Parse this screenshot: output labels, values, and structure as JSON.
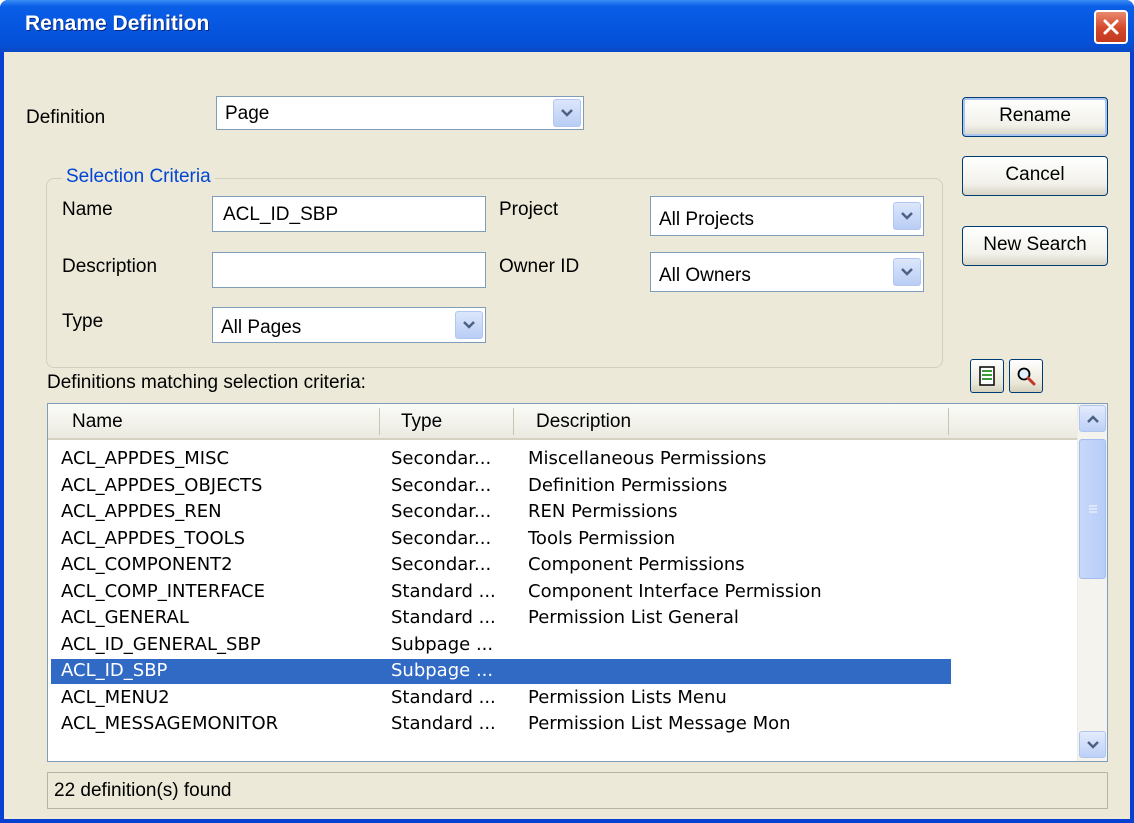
{
  "window": {
    "title": "Rename Definition"
  },
  "definition": {
    "label": "Definition",
    "value": "Page"
  },
  "buttons": {
    "rename": "Rename",
    "cancel": "Cancel",
    "new_search": "New Search"
  },
  "criteria": {
    "title": "Selection Criteria",
    "name_label": "Name",
    "name_value": "ACL_ID_SBP",
    "description_label": "Description",
    "description_value": "",
    "type_label": "Type",
    "type_value": "All Pages",
    "project_label": "Project",
    "project_value": "All Projects",
    "owner_label": "Owner ID",
    "owner_value": "All Owners"
  },
  "list": {
    "caption": "Definitions matching selection criteria:",
    "headers": [
      "Name",
      "Type",
      "Description"
    ],
    "rows": [
      {
        "name": "ACL_APPDES_MISC",
        "type": "Secondar...",
        "desc": "Miscellaneous Permissions"
      },
      {
        "name": "ACL_APPDES_OBJECTS",
        "type": "Secondar...",
        "desc": "Definition Permissions"
      },
      {
        "name": "ACL_APPDES_REN",
        "type": "Secondar...",
        "desc": "REN Permissions"
      },
      {
        "name": "ACL_APPDES_TOOLS",
        "type": "Secondar...",
        "desc": "Tools Permission"
      },
      {
        "name": "ACL_COMPONENT2",
        "type": "Secondar...",
        "desc": "Component Permissions"
      },
      {
        "name": "ACL_COMP_INTERFACE",
        "type": "Standard ...",
        "desc": "Component Interface Permission"
      },
      {
        "name": "ACL_GENERAL",
        "type": "Standard ...",
        "desc": "Permission List General"
      },
      {
        "name": "ACL_ID_GENERAL_SBP",
        "type": "Subpage ...",
        "desc": ""
      },
      {
        "name": "ACL_ID_SBP",
        "type": "Subpage ...",
        "desc": "",
        "selected": true
      },
      {
        "name": "ACL_MENU2",
        "type": "Standard ...",
        "desc": "Permission Lists Menu"
      },
      {
        "name": "ACL_MESSAGEMONITOR",
        "type": "Standard ...",
        "desc": "Permission List Message Mon"
      }
    ]
  },
  "status": {
    "text": "22 definition(s) found"
  },
  "icons": {
    "close": "close-icon",
    "dropdown": "chevron-down-icon",
    "properties": "properties-icon",
    "search": "magnifier-icon"
  },
  "colors": {
    "title_bar": "#0656e0",
    "selection": "#316ac5",
    "group_title": "#0046d5"
  }
}
